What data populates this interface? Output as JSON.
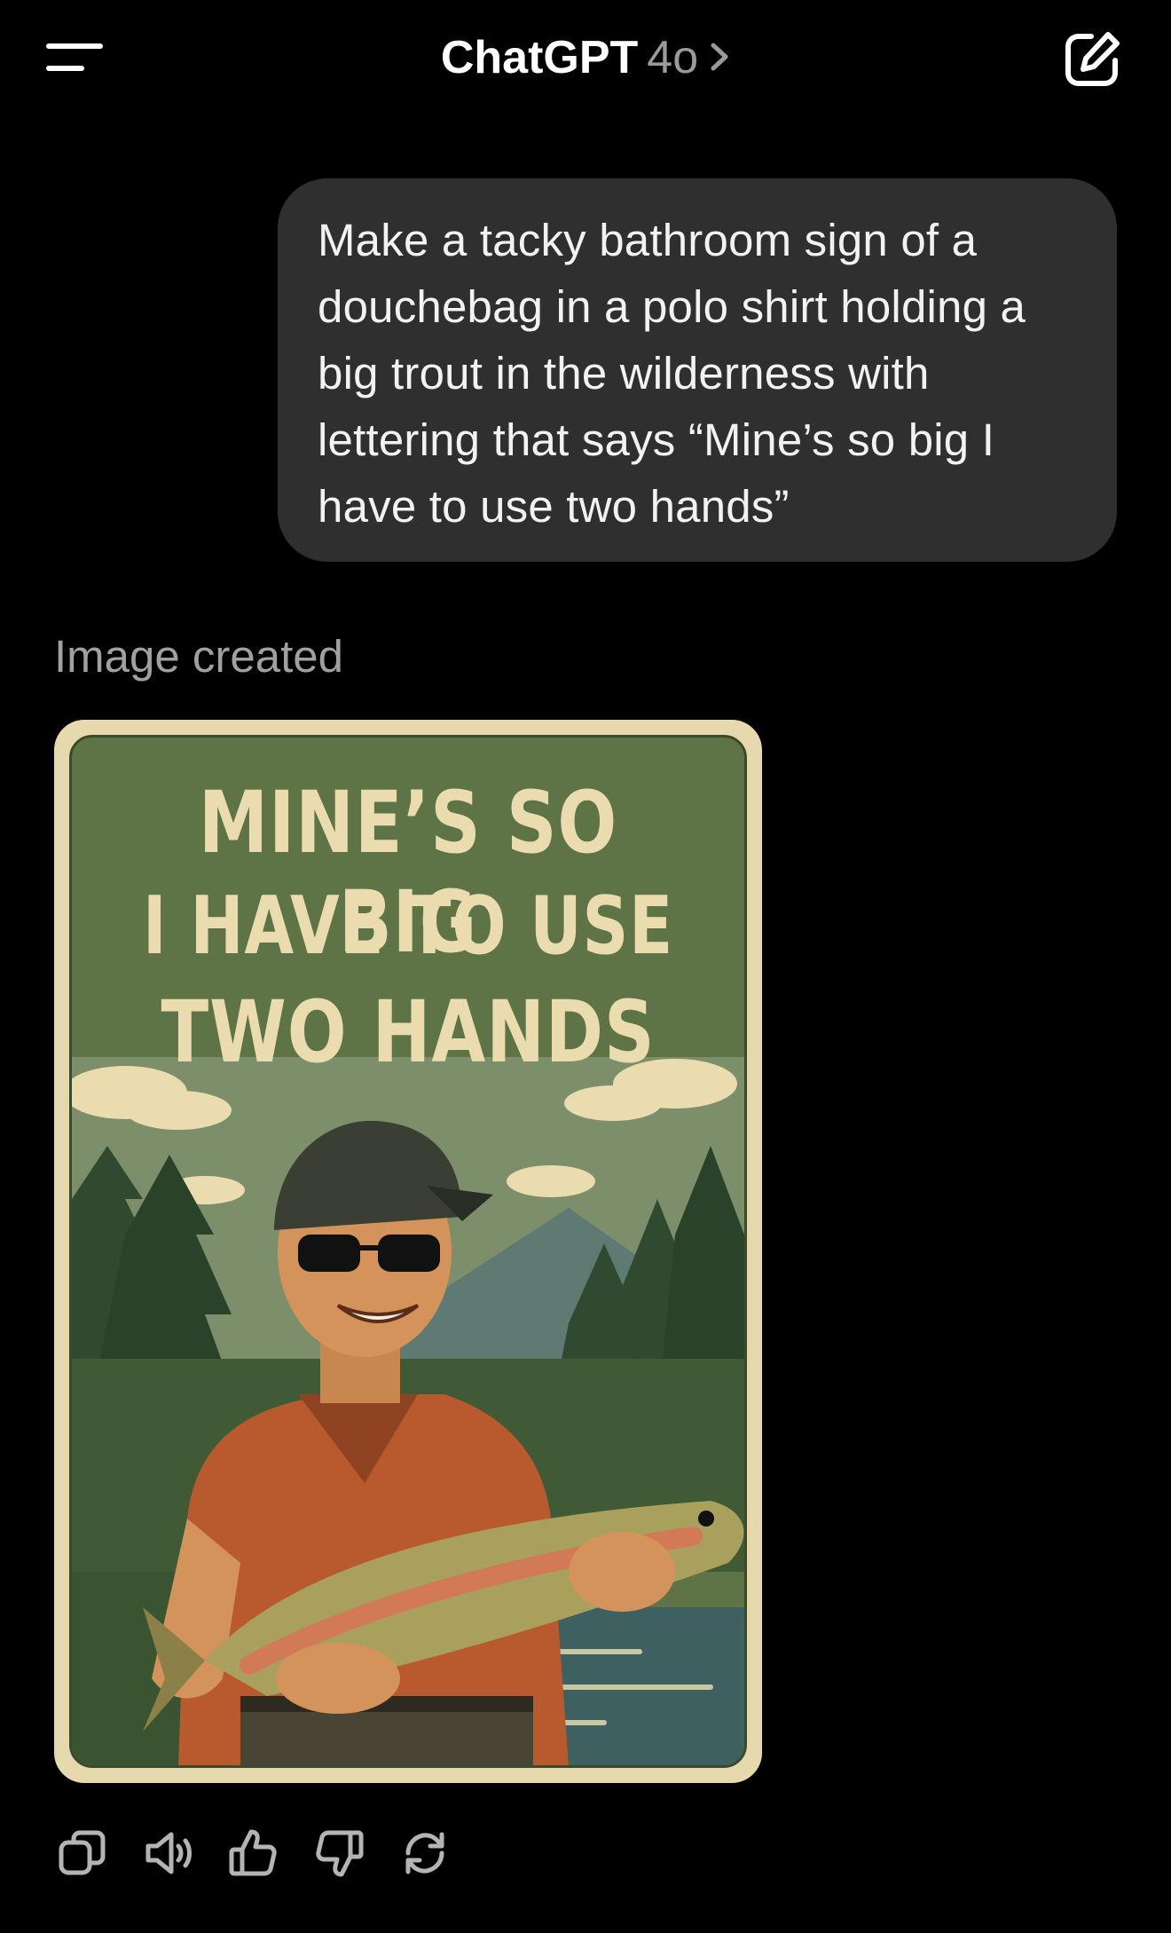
{
  "header": {
    "title": "ChatGPT",
    "model": "4o",
    "icons": [
      "menu-icon",
      "chevron-right-icon",
      "new-chat-icon"
    ]
  },
  "conversation": {
    "user_message": "Make a tacky bathroom sign of a douchebag in a polo shirt holding a big trout in the wilderness with lettering that says “Mine’s so big I have to use two hands”",
    "assistant_label": "Image created",
    "image": {
      "lines": [
        "MINE’S SO BIG",
        "I HAVE TO USE",
        "TWO HANDS"
      ]
    }
  },
  "actions": {
    "icons": [
      "copy-icon",
      "read-aloud-icon",
      "thumbs-up-icon",
      "thumbs-down-icon",
      "regenerate-icon"
    ]
  },
  "colors": {
    "background": "#000000",
    "bubble": "#2f2f2f",
    "muted_text": "#a0a0a0",
    "sign_border": "#e7d9ae",
    "sign_green": "#5e7446"
  }
}
